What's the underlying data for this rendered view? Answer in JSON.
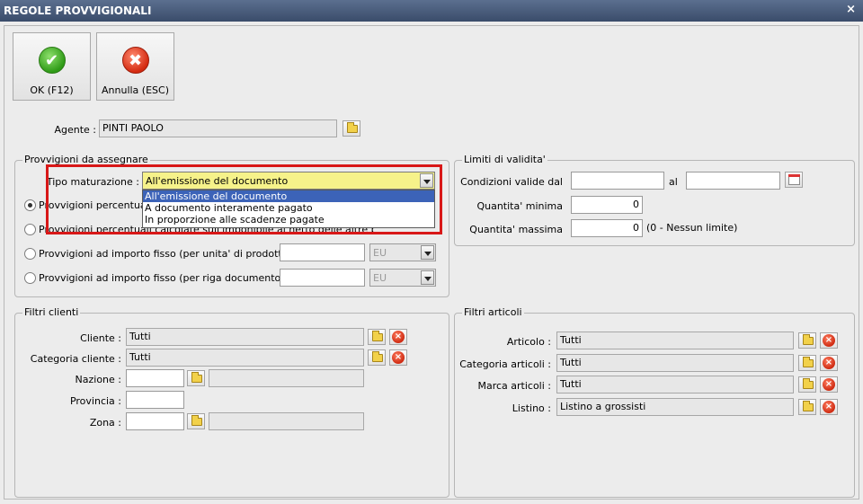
{
  "window": {
    "title": "REGOLE PROVVIGIONALI",
    "close_glyph": "×"
  },
  "toolbar": {
    "ok_label": "OK (F12)",
    "cancel_label": "Annulla (ESC)",
    "ok_icon": "check-icon",
    "cancel_icon": "x-icon"
  },
  "agente": {
    "label": "Agente :",
    "value": "PINTI PAOLO"
  },
  "provvigioni": {
    "title": "Provvigioni da assegnare",
    "tipo_label": "Tipo maturazione :",
    "tipo_value": "All'emissione del documento",
    "dropdown_options": [
      "All'emissione del documento",
      "A documento interamente pagato",
      "In proporzione alle scadenze pagate"
    ],
    "radios": [
      {
        "label": "Provvigioni percentuali c",
        "selected": true
      },
      {
        "label": "Provvigioni percentuali calcolate sull'imponibile al netto delle altre provvigioni",
        "selected": false
      },
      {
        "label": "Provvigioni ad importo fisso (per unita' di prodotto)",
        "selected": false,
        "currency": "EU"
      },
      {
        "label": "Provvigioni ad importo fisso (per riga documento)",
        "selected": false,
        "currency": "EU"
      }
    ]
  },
  "limiti": {
    "title": "Limiti di validita'",
    "condizioni_label": "Condizioni valide dal",
    "al_label": "al",
    "dal_value": "",
    "al_value": "",
    "qmin_label": "Quantita' minima",
    "qmin_value": "0",
    "qmax_label": "Quantita' massima",
    "qmax_value": "0",
    "qmax_note": "(0 - Nessun limite)"
  },
  "filtri_clienti": {
    "title": "Filtri clienti",
    "cliente_label": "Cliente :",
    "cliente_value": "Tutti",
    "categoria_label": "Categoria cliente :",
    "categoria_value": "Tutti",
    "nazione_label": "Nazione :",
    "nazione_value": "",
    "provincia_label": "Provincia :",
    "provincia_value": "",
    "zona_label": "Zona :",
    "zona_value": ""
  },
  "filtri_articoli": {
    "title": "Filtri articoli",
    "articolo_label": "Articolo :",
    "articolo_value": "Tutti",
    "categoria_label": "Categoria articoli :",
    "categoria_value": "Tutti",
    "marca_label": "Marca articoli :",
    "marca_value": "Tutti",
    "listino_label": "Listino :",
    "listino_value": "Listino a grossisti"
  },
  "colors": {
    "highlight": "#d81818",
    "selection": "#3c63b8",
    "combo_yellow": "#f6f28a",
    "titlebar": "#4a5d7d"
  }
}
